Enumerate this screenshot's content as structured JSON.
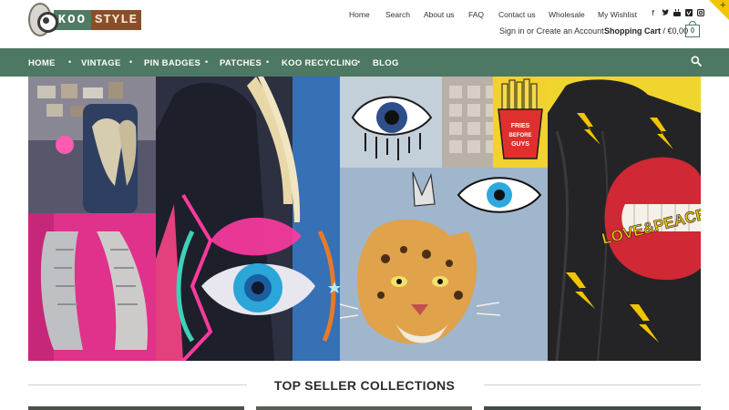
{
  "brand": {
    "logo_part1": "KOO",
    "logo_part2": "STYLE"
  },
  "top_links": [
    "Home",
    "Search",
    "About us",
    "FAQ",
    "Contact us",
    "Wholesale",
    "My Wishlist"
  ],
  "social_icons": [
    "facebook-icon",
    "twitter-icon",
    "youtube-icon",
    "vimeo-icon",
    "instagram-icon"
  ],
  "account": {
    "sign_in": "Sign in",
    "or": "or",
    "create_account": "Create an Account"
  },
  "cart": {
    "label": "Shopping Cart",
    "separator": "/",
    "total": "€0,00",
    "count": "0"
  },
  "nav": {
    "items": [
      "HOME",
      "VINTAGE",
      "PIN BADGES",
      "PATCHES",
      "KOO RECYCLING",
      "BLOG"
    ]
  },
  "hero": {
    "panel_labels": [
      "FRIES BEFORE GUYS",
      "LOVE&PEACE"
    ]
  },
  "section": {
    "title": "TOP SELLER COLLECTIONS"
  },
  "colors": {
    "brand_green": "#4d7863",
    "brand_brown": "#8a4f2a",
    "accent_yellow": "#f2c500"
  }
}
